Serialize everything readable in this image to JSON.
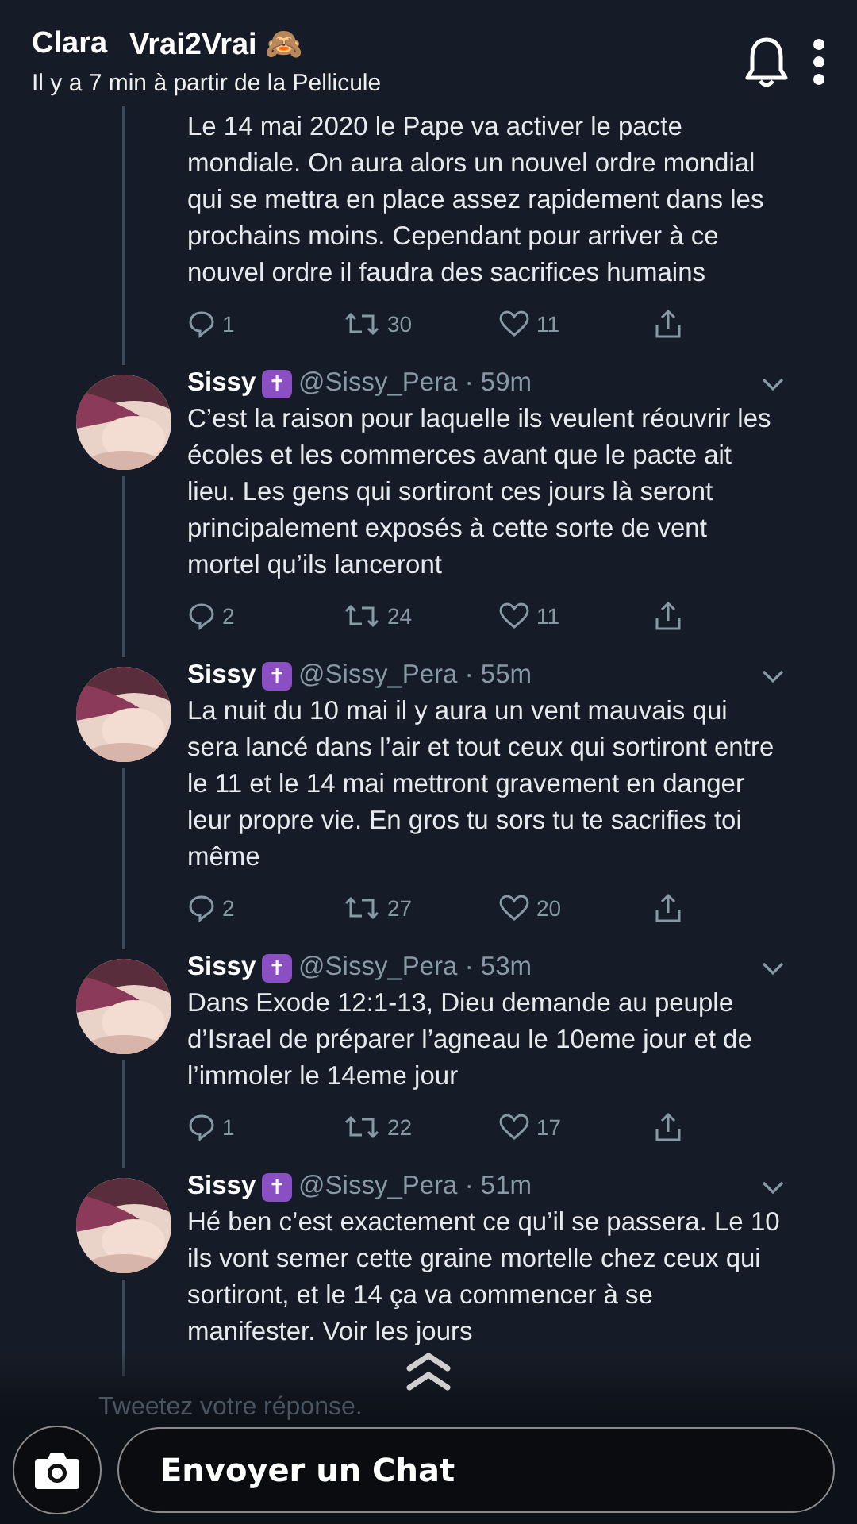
{
  "story": {
    "name": "Clara",
    "title": "Vrai2Vrai 🙈",
    "timestamp": "Il y a 7 min à partir de la Pellicule"
  },
  "tweets": [
    {
      "text": "Le 14 mai 2020 le Pape va activer le pacte mondiale. On aura alors un nouvel ordre mondial qui se mettra en place assez rapidement dans les prochains moins. Cependant pour arriver à ce nouvel ordre il faudra des sacrifices humains",
      "replies": "1",
      "retweets": "30",
      "likes": "11"
    },
    {
      "header": {
        "name": "Sissy",
        "badge": "✝",
        "meta": "@Sissy_Pera · 59m"
      },
      "text": "C’est la raison pour laquelle ils veulent réouvrir les écoles et les commerces avant que le pacte ait lieu. Les gens qui sortiront ces jours là seront principalement exposés à cette sorte de vent mortel qu’ils lanceront",
      "replies": "2",
      "retweets": "24",
      "likes": "11"
    },
    {
      "header": {
        "name": "Sissy",
        "badge": "✝",
        "meta": "@Sissy_Pera · 55m"
      },
      "text": "La nuit du 10 mai il y aura un vent mauvais qui sera lancé dans l’air et tout ceux qui sortiront entre le 11 et le 14 mai mettront gravement en danger leur propre vie. En gros tu sors tu te sacrifies toi même",
      "replies": "2",
      "retweets": "27",
      "likes": "20"
    },
    {
      "header": {
        "name": "Sissy",
        "badge": "✝",
        "meta": "@Sissy_Pera · 53m"
      },
      "text": "Dans Exode 12:1-13, Dieu demande au peuple d’Israel de préparer l’agneau le 10eme jour et de l’immoler le 14eme jour",
      "replies": "1",
      "retweets": "22",
      "likes": "17"
    },
    {
      "header": {
        "name": "Sissy",
        "badge": "✝",
        "meta": "@Sissy_Pera · 51m"
      },
      "text": "Hé ben c’est exactement ce qu’il se passera. Le 10 ils vont semer cette graine mortelle chez ceux qui sortiront, et le 14 ça va commencer à se manifester. Voir les jours"
    }
  ],
  "reply_placeholder": "Tweetez votre réponse.",
  "chat_field": {
    "placeholder": "Envoyer un Chat"
  }
}
